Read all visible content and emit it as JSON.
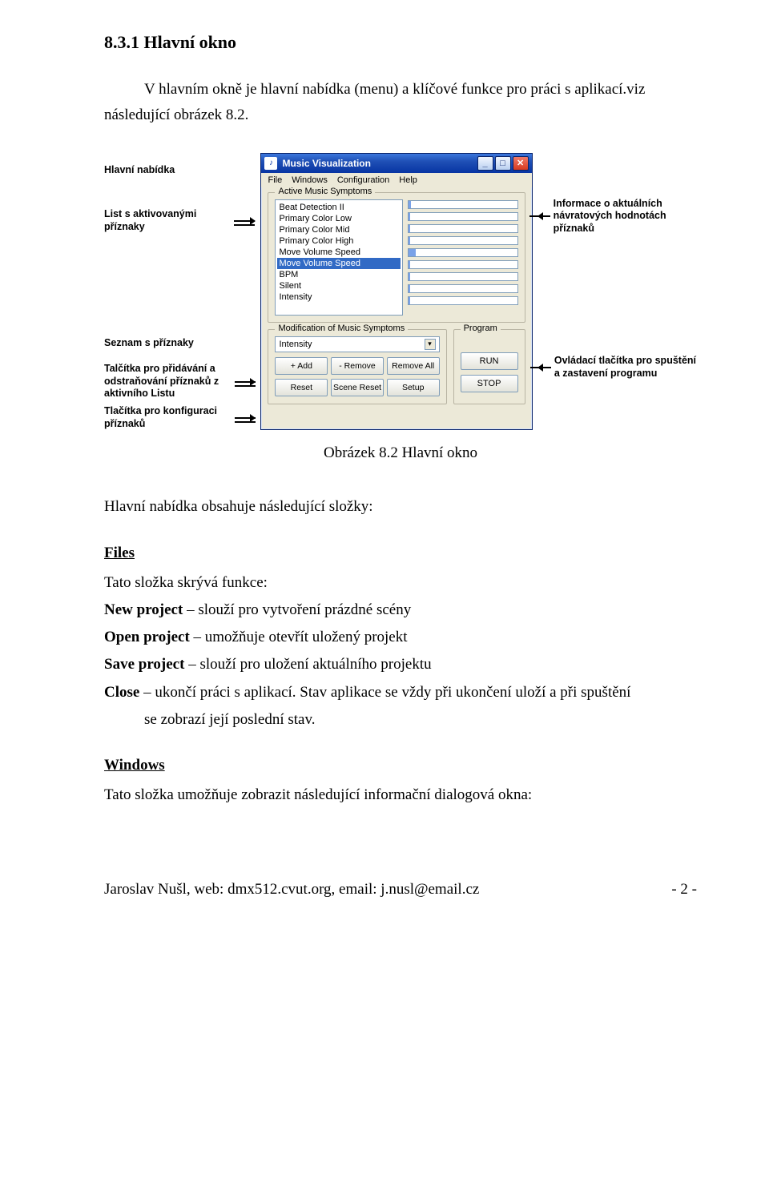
{
  "doc": {
    "section_title": "8.3.1  Hlavní okno",
    "intro": "V hlavním okně je hlavní nabídka (menu) a klíčové funkce pro práci s aplikací.viz následující obrázek 8.2.",
    "caption": "Obrázek 8.2 Hlavní okno",
    "after_caption": "Hlavní nabídka obsahuje následující složky:",
    "files_head": "Files",
    "files_intro": "Tato složka skrývá funkce:",
    "def_new_term": "New project",
    "def_new_desc": " – slouží pro vytvoření prázdné scény",
    "def_open_term": "Open project",
    "def_open_desc": " – umožňuje otevřít uložený projekt",
    "def_save_term": "Save project",
    "def_save_desc": " – slouží pro uložení aktuálního projektu",
    "def_close_term": "Close",
    "def_close_desc1": "  –  ukončí práci s aplikací. Stav aplikace se vždy při ukončení uloží a při spuštění",
    "def_close_desc2": "se zobrazí její poslední stav.",
    "windows_head": "Windows",
    "windows_intro": "Tato složka umožňuje zobrazit následující informační dialogová okna:",
    "footer_left": "Jaroslav Nušl, web: dmx512.cvut.org, email: j.nusl@email.cz",
    "footer_right": "- 2 -"
  },
  "annotations": {
    "left1": "Hlavní nabídka",
    "left2": "List s aktivovanými příznaky",
    "left3": "Seznam s příznaky",
    "left4": "Talčítka pro přidávání a odstraňování příznaků z aktivního Listu",
    "left5": "Tlačítka pro konfiguraci příznaků",
    "right1": "Informace o aktuálních návratových hodnotách příznaků",
    "right2": "Ovládací tlačítka pro spuštění a zastavení programu"
  },
  "window": {
    "title": "Music Visualization",
    "menu": {
      "file": "File",
      "windows": "Windows",
      "config": "Configuration",
      "help": "Help"
    },
    "group_active": "Active Music Symptoms",
    "symptoms": {
      "i0": "Beat Detection II",
      "i1": "Primary Color Low",
      "i2": "Primary Color Mid",
      "i3": "Primary Color High",
      "i4": "Move Volume Speed",
      "i5": "Move Volume Speed",
      "i6": "BPM",
      "i7": "Silent",
      "i8": "Intensity"
    },
    "group_mod": "Modification of Music Symptoms",
    "combo_value": "Intensity",
    "btn_add": "+ Add",
    "btn_remove": "- Remove",
    "btn_removeall": "Remove All",
    "btn_reset": "Reset",
    "btn_sceneReset": "Scene Reset",
    "btn_setup": "Setup",
    "group_prog": "Program",
    "btn_run": "RUN",
    "btn_stop": "STOP"
  }
}
